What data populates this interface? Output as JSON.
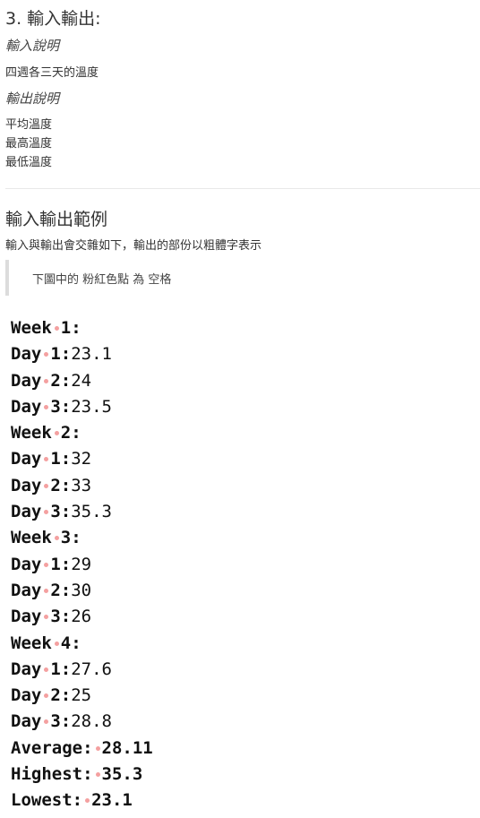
{
  "heading": "3. 輸入輸出:",
  "input_title": "輸入說明",
  "input_desc": "四週各三天的溫度",
  "output_title": "輸出說明",
  "output_lines": [
    "平均溫度",
    "最高溫度",
    "最低溫度"
  ],
  "examples_title": "輸入輸出範例",
  "examples_desc": "輸入與輸出會交雜如下，輸出的部份以粗體字表示",
  "note": "下圖中的 粉紅色點 為 空格",
  "sample": [
    {
      "label": "Week",
      "sep": "1:",
      "value": ""
    },
    {
      "label": "Day",
      "sep": "1:",
      "value": "23.1"
    },
    {
      "label": "Day",
      "sep": "2:",
      "value": "24"
    },
    {
      "label": "Day",
      "sep": "3:",
      "value": "23.5"
    },
    {
      "label": "Week",
      "sep": "2:",
      "value": ""
    },
    {
      "label": "Day",
      "sep": "1:",
      "value": "32"
    },
    {
      "label": "Day",
      "sep": "2:",
      "value": "33"
    },
    {
      "label": "Day",
      "sep": "3:",
      "value": "35.3"
    },
    {
      "label": "Week",
      "sep": "3:",
      "value": ""
    },
    {
      "label": "Day",
      "sep": "1:",
      "value": "29"
    },
    {
      "label": "Day",
      "sep": "2:",
      "value": "30"
    },
    {
      "label": "Day",
      "sep": "3:",
      "value": "26"
    },
    {
      "label": "Week",
      "sep": "4:",
      "value": ""
    },
    {
      "label": "Day",
      "sep": "1:",
      "value": "27.6"
    },
    {
      "label": "Day",
      "sep": "2:",
      "value": "25"
    },
    {
      "label": "Day",
      "sep": "3:",
      "value": "28.8"
    }
  ],
  "results": [
    {
      "label": "Average:",
      "value": "28.11"
    },
    {
      "label": "Highest:",
      "value": "35.3"
    },
    {
      "label": "Lowest:",
      "value": "23.1"
    }
  ],
  "colors": {
    "space_dot": "#f4a0a0"
  }
}
